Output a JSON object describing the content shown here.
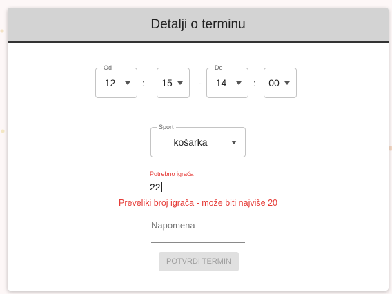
{
  "dialog": {
    "title": "Detalji o terminu",
    "time": {
      "from_label": "Od",
      "from_hour": "12",
      "from_minute": "15",
      "to_label": "Do",
      "to_hour": "14",
      "to_minute": "00",
      "colon": ":",
      "dash": "-"
    },
    "sport": {
      "label": "Sport",
      "value": "košarka"
    },
    "players": {
      "label": "Potrebno igrača",
      "value": "22",
      "error": "Preveliki broj igrača - može biti najviše 20"
    },
    "note": {
      "placeholder": "Napomena"
    },
    "confirm_button": "POTVRDI TERMIN"
  },
  "colors": {
    "header_bg": "#d3d3d3",
    "error": "#e53935",
    "button_disabled_bg": "#e0e0e0"
  }
}
